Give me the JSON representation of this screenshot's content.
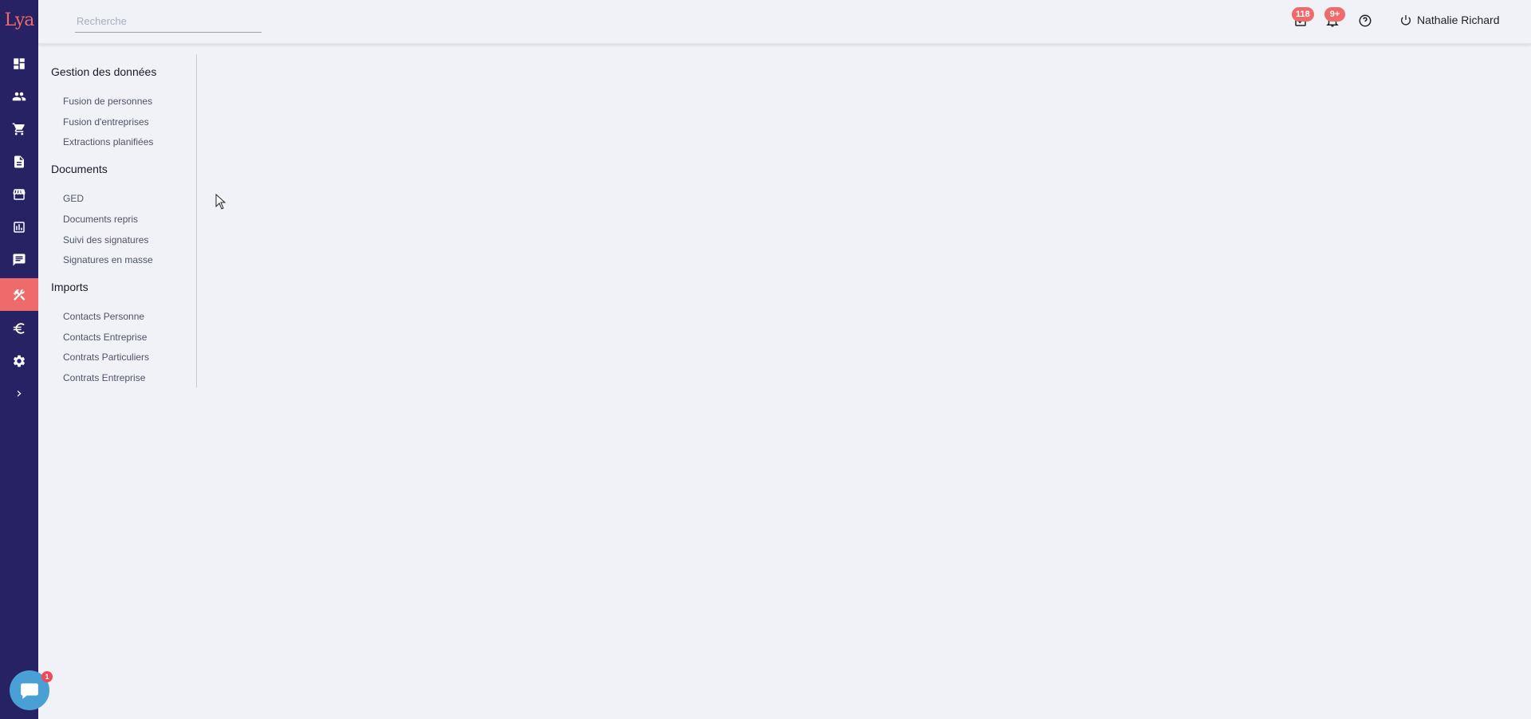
{
  "app": {
    "logo_text": "Lya",
    "brand_color": "#ef6b6b",
    "rail_color": "#262263"
  },
  "search": {
    "placeholder": "Recherche",
    "value": ""
  },
  "rail": {
    "items": [
      {
        "icon": "dashboard-icon"
      },
      {
        "icon": "people-icon"
      },
      {
        "icon": "cart-icon"
      },
      {
        "icon": "document-icon"
      },
      {
        "icon": "store-icon"
      },
      {
        "icon": "chart-icon"
      },
      {
        "icon": "chat-icon"
      },
      {
        "icon": "tools-icon",
        "active": true
      },
      {
        "icon": "euro-icon"
      },
      {
        "icon": "gear-icon"
      },
      {
        "icon": "chevron-right-icon"
      }
    ]
  },
  "topbar": {
    "tasks_badge": "118",
    "notifications_badge": "9+",
    "help_icon": "help-icon",
    "user_name": "Nathalie Richard"
  },
  "menu": {
    "sections": [
      {
        "title": "Gestion des données",
        "links": [
          "Fusion de personnes",
          "Fusion d'entreprises",
          "Extractions planifiées"
        ]
      },
      {
        "title": "Documents",
        "links": [
          "GED",
          "Documents repris",
          "Suivi des signatures",
          "Signatures en masse"
        ]
      },
      {
        "title": "Imports",
        "links": [
          "Contacts Personne",
          "Contacts Entreprise",
          "Contrats Particuliers",
          "Contrats Entreprise"
        ]
      }
    ]
  },
  "chat": {
    "badge": "1"
  }
}
